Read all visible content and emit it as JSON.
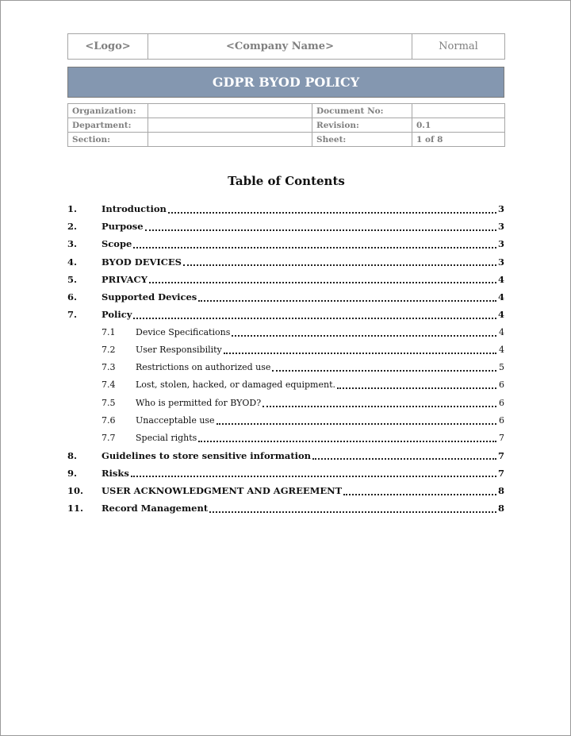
{
  "header": {
    "logo": "<Logo>",
    "company_name": "<Company Name>",
    "classification": "Normal"
  },
  "title": "GDPR BYOD POLICY",
  "info": {
    "organization_label": "Organization:",
    "organization_value": "",
    "department_label": "Department:",
    "department_value": "",
    "section_label": "Section:",
    "section_value": "",
    "document_no_label": "Document No:",
    "document_no_value": "",
    "revision_label": "Revision:",
    "revision_value": "0.1",
    "sheet_label": "Sheet:",
    "sheet_value": "1 of 8"
  },
  "toc": {
    "heading": "Table of Contents",
    "entries": [
      {
        "num": "1.",
        "label": "Introduction",
        "page": "3",
        "level": 1
      },
      {
        "num": "2.",
        "label": "Purpose",
        "page": "3",
        "level": 1
      },
      {
        "num": "3.",
        "label": "Scope",
        "page": "3",
        "level": 1
      },
      {
        "num": "4.",
        "label": "BYOD DEVICES",
        "page": "3",
        "level": 1
      },
      {
        "num": "5.",
        "label": "PRIVACY",
        "page": "4",
        "level": 1
      },
      {
        "num": "6.",
        "label": "Supported Devices",
        "page": "4",
        "level": 1
      },
      {
        "num": "7.",
        "label": "Policy",
        "page": "4",
        "level": 1
      },
      {
        "num": "7.1",
        "label": "Device Specifications",
        "page": "4",
        "level": 2
      },
      {
        "num": "7.2",
        "label": "User Responsibility",
        "page": "4",
        "level": 2
      },
      {
        "num": "7.3",
        "label": "Restrictions on authorized use",
        "page": "5",
        "level": 2
      },
      {
        "num": "7.4",
        "label": "Lost, stolen, hacked, or damaged equipment.",
        "page": "6",
        "level": 2
      },
      {
        "num": "7.5",
        "label": "Who is permitted for BYOD?",
        "page": "6",
        "level": 2
      },
      {
        "num": "7.6",
        "label": "Unacceptable use",
        "page": "6",
        "level": 2
      },
      {
        "num": "7.7",
        "label": "Special rights",
        "page": "7",
        "level": 2
      },
      {
        "num": "8.",
        "label": "Guidelines to store sensitive information",
        "page": "7",
        "level": 1
      },
      {
        "num": "9.",
        "label": "Risks",
        "page": "7",
        "level": 1
      },
      {
        "num": "10.",
        "label": "USER ACKNOWLEDGMENT AND AGREEMENT",
        "page": "8",
        "level": 1
      },
      {
        "num": "11.",
        "label": "Record Management",
        "page": "8",
        "level": 1
      }
    ]
  }
}
